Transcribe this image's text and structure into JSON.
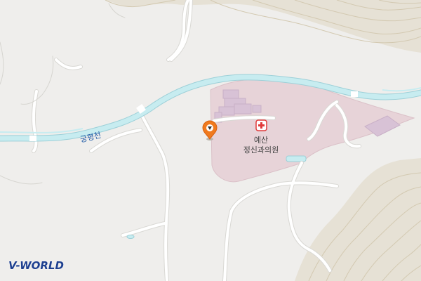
{
  "map": {
    "labels": {
      "stream": "궁평천",
      "hospital_line1": "예산",
      "hospital_line2": "정신과의원"
    },
    "branding": {
      "logo_text": "V-WORLD"
    },
    "colors": {
      "land": "#efeeec",
      "terrain": "#e5e0d3",
      "contour": "#cfc6ad",
      "water": "#c7ecf0",
      "water_edge": "#9dd0d8",
      "hospital_area": "#e7d3d8",
      "building": "#d8c2d6",
      "road": "#ffffff",
      "road_edge": "#d9d8d4",
      "hospital_icon": "#e03a3a",
      "marker": "#f07a1e",
      "logo_blue": "#1d3f8f"
    },
    "icons": {
      "hospital": "hospital-cross-icon",
      "marker": "location-pin-icon"
    }
  }
}
